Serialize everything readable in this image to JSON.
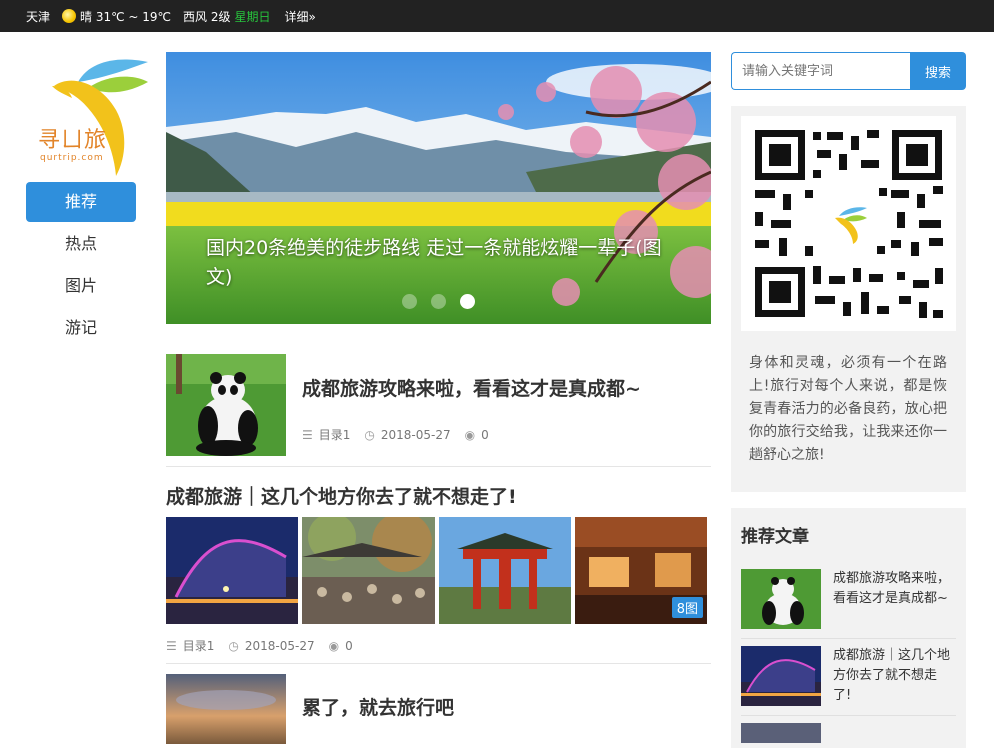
{
  "topbar": {
    "city": "天津",
    "weather": "晴 31℃ ~ 19℃",
    "wind": "西风 2级",
    "weekday": "星期日",
    "detail": "详细»"
  },
  "logo": {
    "text": "寻ㄩ旅",
    "sub": "qurtrip.com"
  },
  "nav": {
    "items": [
      {
        "label": "推荐"
      },
      {
        "label": "热点"
      },
      {
        "label": "图片"
      },
      {
        "label": "游记"
      }
    ]
  },
  "slider": {
    "title": "国内20条绝美的徒步路线 走过一条就能炫耀一辈子(图文)"
  },
  "articles": [
    {
      "title": "成都旅游攻略来啦，看看这才是真成都~",
      "category": "目录1",
      "date": "2018-05-27",
      "views": "0"
    },
    {
      "title": "成都旅游｜这几个地方你去了就不想走了!",
      "category": "目录1",
      "date": "2018-05-27",
      "views": "0",
      "pic_count": "8图"
    },
    {
      "title": "累了，就去旅行吧"
    }
  ],
  "search": {
    "placeholder": "请输入关键字词",
    "button": "搜索"
  },
  "qr": {
    "text": "身体和灵魂，必须有一个在路上!旅行对每个人来说，都是恢复青春活力的必备良药，放心把你的旅行交给我，让我来还你一趟舒心之旅!"
  },
  "recommend": {
    "title": "推荐文章",
    "items": [
      {
        "title": "成都旅游攻略来啦，看看这才是真成都~"
      },
      {
        "title": "成都旅游｜这几个地方你去了就不想走了!"
      }
    ]
  },
  "colors": {
    "accent": "#2f8fdc",
    "topbar": "#222222",
    "weekday": "#27c43c",
    "logo": "#e28429"
  }
}
